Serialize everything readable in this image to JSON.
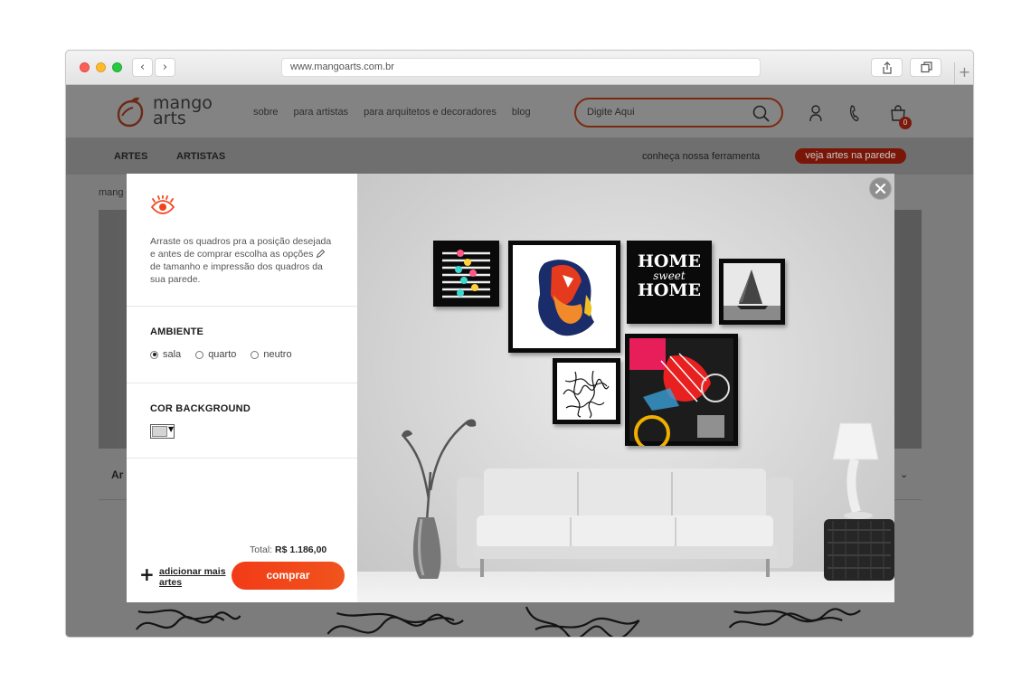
{
  "browser": {
    "url": "www.mangoarts.com.br",
    "back_icon": "‹",
    "forward_icon": "›",
    "new_tab": "+"
  },
  "site": {
    "logo": {
      "line1": "mango",
      "line2": "arts"
    },
    "nav": [
      "sobre",
      "para artistas",
      "para arquitetos e decoradores",
      "blog"
    ],
    "search_placeholder": "Digite Aqui",
    "cart_count": "0",
    "subnav": {
      "artes": "ARTES",
      "artistas": "ARTISTAS",
      "tool": "conheça nossa ferramenta",
      "wall_button": "veja artes na parede"
    },
    "breadcrumb": "mang",
    "art_caption": "Ar",
    "chevron": "⌄"
  },
  "modal": {
    "instructions_before": "Arraste os quadros pra a posição desejada e antes de comprar escolha as opções",
    "instructions_after": "de tamanho e impressão dos quadros da sua parede.",
    "ambiente_title": "AMBIENTE",
    "ambiente_options": [
      {
        "label": "sala",
        "selected": true
      },
      {
        "label": "quarto",
        "selected": false
      },
      {
        "label": "neutro",
        "selected": false
      }
    ],
    "background_title": "COR BACKGROUND",
    "background_color": "#d4d4d4",
    "total_label": "Total:",
    "total_value": "R$ 1.186,00",
    "add_more": "adicionar mais artes",
    "buy_button": "comprar",
    "frame_texts": {
      "home1": "HOME",
      "sweet": "sweet",
      "home2": "HOME"
    }
  },
  "colors": {
    "accent": "#f0451b",
    "brand_dark": "#7a1608"
  }
}
